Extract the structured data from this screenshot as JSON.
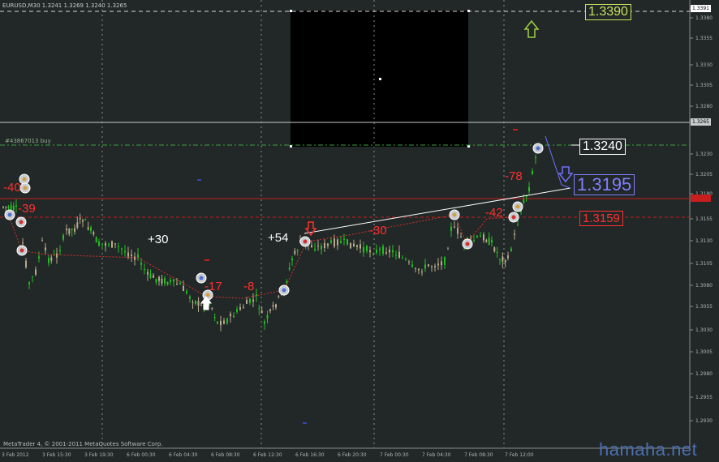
{
  "window": {
    "symbol_header": "EURUSD,M30  1.3241 1.3269 1.3240 1.3265",
    "order_label": "#43867013 buy",
    "copyright": "MetaTrader 4, © 2001-2011 MetaQuotes Software Corp.",
    "watermark": "hamaha.net"
  },
  "price_axis": {
    "labels": [
      "1.3391",
      "1.3380",
      "1.3355",
      "1.3330",
      "1.3305",
      "1.3280",
      "1.3265",
      "1.3230",
      "1.3205",
      "1.3180",
      "1.3155",
      "1.3130",
      "1.3105",
      "1.3080",
      "1.3055",
      "1.3030",
      "1.3005",
      "1.2980",
      "1.2955",
      "1.2930"
    ],
    "current_price": "1.3265",
    "red_tag": "1.3180",
    "top_tag": "1.3391"
  },
  "time_axis": {
    "labels": [
      "3 Feb 2012",
      "3 Feb 15:30",
      "3 Feb 19:30",
      "6 Feb 00:30",
      "6 Feb 04:30",
      "6 Feb 08:30",
      "6 Feb 12:30",
      "6 Feb 16:30",
      "6 Feb 20:30",
      "7 Feb 00:30",
      "7 Feb 04:30",
      "7 Feb 08:30",
      "7 Feb 12:00"
    ]
  },
  "annotations": {
    "levels": {
      "l1": "1.3390",
      "l2": "1.3240",
      "l3": "1.3195",
      "l4": "1.3159"
    },
    "labels": [
      {
        "text": "-40",
        "color": "#ff3030"
      },
      {
        "text": "-39",
        "color": "#ff3030"
      },
      {
        "text": "+30",
        "color": "#ffffff"
      },
      {
        "text": "-17",
        "color": "#ff3030"
      },
      {
        "text": "-8",
        "color": "#ff3030"
      },
      {
        "text": "+54",
        "color": "#ffffff"
      },
      {
        "text": "-30",
        "color": "#ff3030"
      },
      {
        "text": "-42",
        "color": "#ff3030"
      },
      {
        "text": "-78",
        "color": "#ff3030"
      }
    ]
  },
  "colors": {
    "background": "#222827",
    "bull": "#22c022",
    "bear": "#b9a98c",
    "red_line": "#c81e1e",
    "green_line": "#3ca03c",
    "arrow_green": "#a0d040",
    "arrow_blue": "#7070ff"
  },
  "icons": {
    "up_arrow": "hollow-up-arrow",
    "down_arrow": "hollow-down-arrow",
    "order_marker": "circle-marker"
  }
}
